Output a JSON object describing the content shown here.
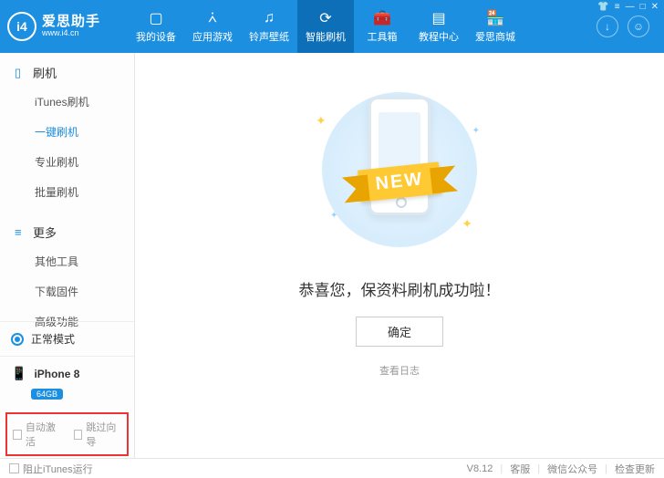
{
  "app": {
    "name": "爱思助手",
    "url": "www.i4.cn"
  },
  "nav": [
    {
      "label": "我的设备",
      "icon": "▢"
    },
    {
      "label": "应用游戏",
      "icon": "⩑"
    },
    {
      "label": "铃声壁纸",
      "icon": "♫"
    },
    {
      "label": "智能刷机",
      "icon": "⟳",
      "active": true
    },
    {
      "label": "工具箱",
      "icon": "🧰"
    },
    {
      "label": "教程中心",
      "icon": "▤"
    },
    {
      "label": "爱思商城",
      "icon": "🏪"
    }
  ],
  "sidebar": {
    "group1": {
      "title": "刷机",
      "items": [
        "iTunes刷机",
        "一键刷机",
        "专业刷机",
        "批量刷机"
      ],
      "activeIndex": 1
    },
    "group2": {
      "title": "更多",
      "items": [
        "其他工具",
        "下载固件",
        "高级功能"
      ]
    },
    "mode": "正常模式",
    "device": {
      "name": "iPhone 8",
      "storage": "64GB"
    },
    "checks": {
      "autoActivate": "自动激活",
      "skipGuide": "跳过向导"
    }
  },
  "main": {
    "ribbon": "NEW",
    "successText": "恭喜您，保资料刷机成功啦！",
    "okButton": "确定",
    "logLink": "查看日志"
  },
  "footer": {
    "blockItunes": "阻止iTunes运行",
    "version": "V8.12",
    "support": "客服",
    "wechat": "微信公众号",
    "update": "检查更新"
  }
}
